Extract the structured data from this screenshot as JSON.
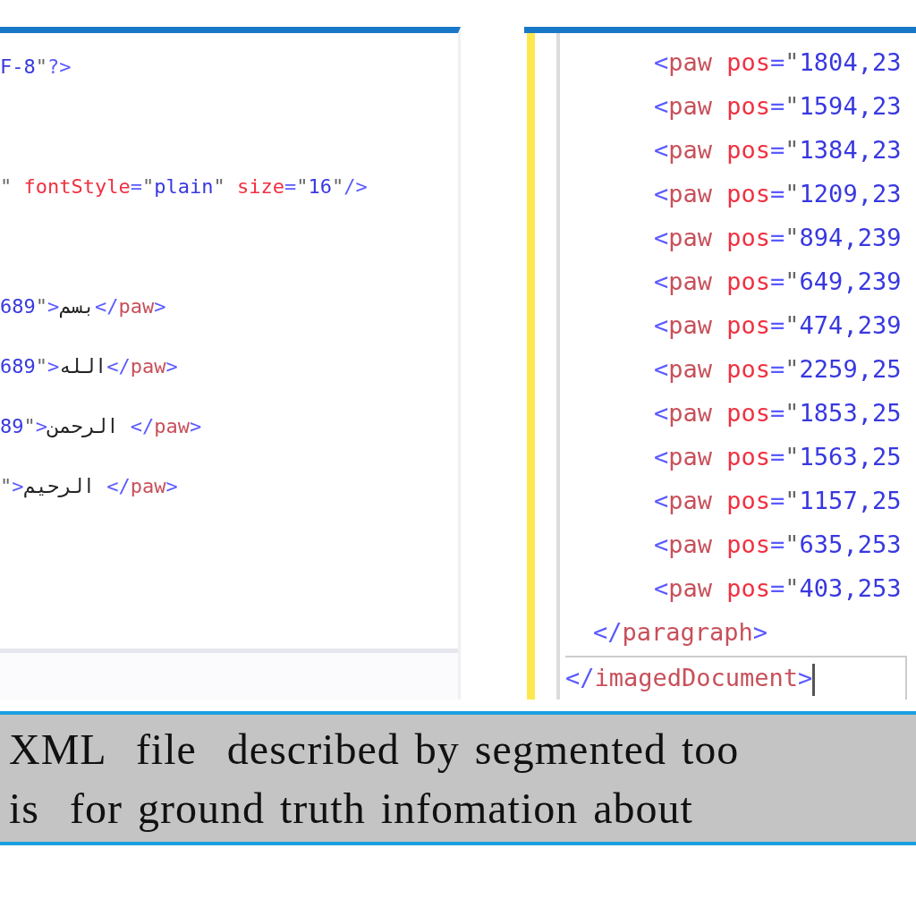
{
  "left_editor": {
    "lines": [
      [
        {
          "kind": "value",
          "text": "F-8"
        },
        {
          "kind": "quote",
          "text": "\""
        },
        {
          "kind": "bracket",
          "text": "?>"
        }
      ],
      [
        {
          "kind": "quote",
          "text": "\" "
        },
        {
          "kind": "attr",
          "text": "fontStyle"
        },
        {
          "kind": "bracket",
          "text": "="
        },
        {
          "kind": "quote",
          "text": "\""
        },
        {
          "kind": "value",
          "text": "plain"
        },
        {
          "kind": "quote",
          "text": "\" "
        },
        {
          "kind": "attr",
          "text": "size"
        },
        {
          "kind": "bracket",
          "text": "="
        },
        {
          "kind": "quote",
          "text": "\""
        },
        {
          "kind": "value",
          "text": "16"
        },
        {
          "kind": "quote",
          "text": "\""
        },
        {
          "kind": "bracket",
          "text": "/>"
        }
      ],
      [
        {
          "kind": "value",
          "text": "689"
        },
        {
          "kind": "quote",
          "text": "\""
        },
        {
          "kind": "bracket",
          "text": ">"
        },
        {
          "kind": "text",
          "text": "بسم"
        },
        {
          "kind": "bracket",
          "text": "</"
        },
        {
          "kind": "tag",
          "text": "paw"
        },
        {
          "kind": "bracket",
          "text": ">"
        }
      ],
      [
        {
          "kind": "value",
          "text": "689"
        },
        {
          "kind": "quote",
          "text": "\""
        },
        {
          "kind": "bracket",
          "text": ">"
        },
        {
          "kind": "text",
          "text": "الله"
        },
        {
          "kind": "bracket",
          "text": "</"
        },
        {
          "kind": "tag",
          "text": "paw"
        },
        {
          "kind": "bracket",
          "text": ">"
        }
      ],
      [
        {
          "kind": "value",
          "text": "89"
        },
        {
          "kind": "quote",
          "text": "\""
        },
        {
          "kind": "bracket",
          "text": ">"
        },
        {
          "kind": "text",
          "text": "الرحمن "
        },
        {
          "kind": "bracket",
          "text": "</"
        },
        {
          "kind": "tag",
          "text": "paw"
        },
        {
          "kind": "bracket",
          "text": ">"
        }
      ],
      [
        {
          "kind": "quote",
          "text": "\""
        },
        {
          "kind": "bracket",
          "text": ">"
        },
        {
          "kind": "text",
          "text": "الرحيم "
        },
        {
          "kind": "bracket",
          "text": "</"
        },
        {
          "kind": "tag",
          "text": "paw"
        },
        {
          "kind": "bracket",
          "text": ">"
        }
      ]
    ]
  },
  "right_editor": {
    "document": {
      "current": true,
      "closing": [
        {
          "kind": "bracket",
          "text": "</"
        },
        {
          "kind": "tag",
          "text": "imagedDocument"
        },
        {
          "kind": "bracket",
          "text": ">"
        }
      ],
      "children": [
        {
          "current": false,
          "closing": [
            {
              "kind": "bracket",
              "text": "</"
            },
            {
              "kind": "tag",
              "text": "paragraph"
            },
            {
              "kind": "bracket",
              "text": ">"
            }
          ],
          "children": [
            {
              "current": false,
              "line": [
                {
                  "kind": "bracket",
                  "text": "<"
                },
                {
                  "kind": "tag",
                  "text": "paw "
                },
                {
                  "kind": "attr",
                  "text": "pos"
                },
                {
                  "kind": "bracket",
                  "text": "="
                },
                {
                  "kind": "quote",
                  "text": "\""
                },
                {
                  "kind": "value",
                  "text": "1804,23"
                }
              ]
            },
            {
              "current": false,
              "line": [
                {
                  "kind": "bracket",
                  "text": "<"
                },
                {
                  "kind": "tag",
                  "text": "paw "
                },
                {
                  "kind": "attr",
                  "text": "pos"
                },
                {
                  "kind": "bracket",
                  "text": "="
                },
                {
                  "kind": "quote",
                  "text": "\""
                },
                {
                  "kind": "value",
                  "text": "1594,23"
                }
              ]
            },
            {
              "current": false,
              "line": [
                {
                  "kind": "bracket",
                  "text": "<"
                },
                {
                  "kind": "tag",
                  "text": "paw "
                },
                {
                  "kind": "attr",
                  "text": "pos"
                },
                {
                  "kind": "bracket",
                  "text": "="
                },
                {
                  "kind": "quote",
                  "text": "\""
                },
                {
                  "kind": "value",
                  "text": "1384,23"
                }
              ]
            },
            {
              "current": false,
              "line": [
                {
                  "kind": "bracket",
                  "text": "<"
                },
                {
                  "kind": "tag",
                  "text": "paw "
                },
                {
                  "kind": "attr",
                  "text": "pos"
                },
                {
                  "kind": "bracket",
                  "text": "="
                },
                {
                  "kind": "quote",
                  "text": "\""
                },
                {
                  "kind": "value",
                  "text": "1209,23"
                }
              ]
            },
            {
              "current": false,
              "line": [
                {
                  "kind": "bracket",
                  "text": "<"
                },
                {
                  "kind": "tag",
                  "text": "paw "
                },
                {
                  "kind": "attr",
                  "text": "pos"
                },
                {
                  "kind": "bracket",
                  "text": "="
                },
                {
                  "kind": "quote",
                  "text": "\""
                },
                {
                  "kind": "value",
                  "text": "894,239"
                }
              ]
            },
            {
              "current": false,
              "line": [
                {
                  "kind": "bracket",
                  "text": "<"
                },
                {
                  "kind": "tag",
                  "text": "paw "
                },
                {
                  "kind": "attr",
                  "text": "pos"
                },
                {
                  "kind": "bracket",
                  "text": "="
                },
                {
                  "kind": "quote",
                  "text": "\""
                },
                {
                  "kind": "value",
                  "text": "649,239"
                }
              ]
            },
            {
              "current": false,
              "line": [
                {
                  "kind": "bracket",
                  "text": "<"
                },
                {
                  "kind": "tag",
                  "text": "paw "
                },
                {
                  "kind": "attr",
                  "text": "pos"
                },
                {
                  "kind": "bracket",
                  "text": "="
                },
                {
                  "kind": "quote",
                  "text": "\""
                },
                {
                  "kind": "value",
                  "text": "474,239"
                }
              ]
            },
            {
              "current": false,
              "line": [
                {
                  "kind": "bracket",
                  "text": "<"
                },
                {
                  "kind": "tag",
                  "text": "paw "
                },
                {
                  "kind": "attr",
                  "text": "pos"
                },
                {
                  "kind": "bracket",
                  "text": "="
                },
                {
                  "kind": "quote",
                  "text": "\""
                },
                {
                  "kind": "value",
                  "text": "2259,25"
                }
              ]
            },
            {
              "current": false,
              "line": [
                {
                  "kind": "bracket",
                  "text": "<"
                },
                {
                  "kind": "tag",
                  "text": "paw "
                },
                {
                  "kind": "attr",
                  "text": "pos"
                },
                {
                  "kind": "bracket",
                  "text": "="
                },
                {
                  "kind": "quote",
                  "text": "\""
                },
                {
                  "kind": "value",
                  "text": "1853,25"
                }
              ]
            },
            {
              "current": false,
              "line": [
                {
                  "kind": "bracket",
                  "text": "<"
                },
                {
                  "kind": "tag",
                  "text": "paw "
                },
                {
                  "kind": "attr",
                  "text": "pos"
                },
                {
                  "kind": "bracket",
                  "text": "="
                },
                {
                  "kind": "quote",
                  "text": "\""
                },
                {
                  "kind": "value",
                  "text": "1563,25"
                }
              ]
            },
            {
              "current": false,
              "line": [
                {
                  "kind": "bracket",
                  "text": "<"
                },
                {
                  "kind": "tag",
                  "text": "paw "
                },
                {
                  "kind": "attr",
                  "text": "pos"
                },
                {
                  "kind": "bracket",
                  "text": "="
                },
                {
                  "kind": "quote",
                  "text": "\""
                },
                {
                  "kind": "value",
                  "text": "1157,25"
                }
              ]
            },
            {
              "current": false,
              "line": [
                {
                  "kind": "bracket",
                  "text": "<"
                },
                {
                  "kind": "tag",
                  "text": "paw "
                },
                {
                  "kind": "attr",
                  "text": "pos"
                },
                {
                  "kind": "bracket",
                  "text": "="
                },
                {
                  "kind": "quote",
                  "text": "\""
                },
                {
                  "kind": "value",
                  "text": "635,253"
                }
              ]
            },
            {
              "current": false,
              "line": [
                {
                  "kind": "bracket",
                  "text": "<"
                },
                {
                  "kind": "tag",
                  "text": "paw "
                },
                {
                  "kind": "attr",
                  "text": "pos"
                },
                {
                  "kind": "bracket",
                  "text": "="
                },
                {
                  "kind": "quote",
                  "text": "\""
                },
                {
                  "kind": "value",
                  "text": "403,253"
                }
              ]
            }
          ]
        }
      ]
    }
  },
  "caption": {
    "lines": [
      "XML  file  described by segmented too",
      "is  for ground truth infomation about"
    ]
  }
}
